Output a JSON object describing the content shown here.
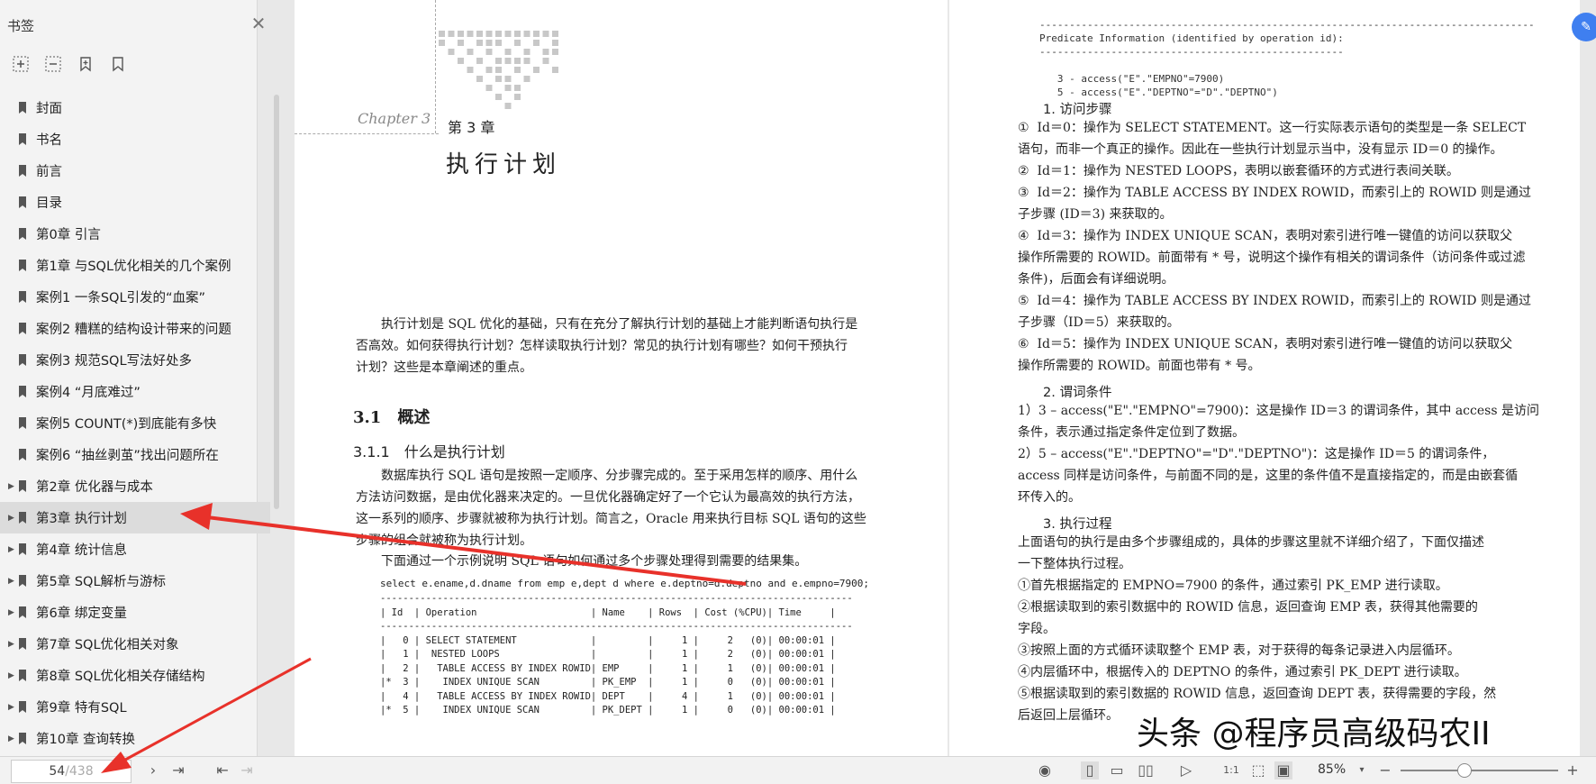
{
  "sidebar": {
    "title": "书签",
    "items": [
      {
        "label": "封面",
        "expandable": false
      },
      {
        "label": "书名",
        "expandable": false
      },
      {
        "label": "前言",
        "expandable": false
      },
      {
        "label": "目录",
        "expandable": false
      },
      {
        "label": "第0章 引言",
        "expandable": false
      },
      {
        "label": "第1章 与SQL优化相关的几个案例",
        "expandable": false
      },
      {
        "label": "案例1 一条SQL引发的“血案”",
        "expandable": false
      },
      {
        "label": "案例2 糟糕的结构设计带来的问题",
        "expandable": false
      },
      {
        "label": "案例3 规范SQL写法好处多",
        "expandable": false
      },
      {
        "label": "案例4 “月底难过”",
        "expandable": false
      },
      {
        "label": "案例5 COUNT(*)到底能有多快",
        "expandable": false
      },
      {
        "label": "案例6 “抽丝剥茧”找出问题所在",
        "expandable": false
      },
      {
        "label": "第2章 优化器与成本",
        "expandable": true
      },
      {
        "label": "第3章 执行计划",
        "expandable": true,
        "active": true
      },
      {
        "label": "第4章 统计信息",
        "expandable": true
      },
      {
        "label": "第5章 SQL解析与游标",
        "expandable": true
      },
      {
        "label": "第6章 绑定变量",
        "expandable": true
      },
      {
        "label": "第7章 SQL优化相关对象",
        "expandable": true
      },
      {
        "label": "第8章 SQL优化相关存储结构",
        "expandable": true
      },
      {
        "label": "第9章 特有SQL",
        "expandable": true
      },
      {
        "label": "第10章 查询转换",
        "expandable": true
      }
    ]
  },
  "page_left": {
    "chapter_cursive": "Chapter 3",
    "chapter_num": "第 3 章",
    "chapter_title": "执行计划",
    "intro": [
      "执行计划是 SQL 优化的基础，只有在充分了解执行计划的基础上才能判断语句执行是",
      "否高效。如何获得执行计划？怎样读取执行计划？常见的执行计划有哪些？如何干预执行",
      "计划？这些是本章阐述的重点。"
    ],
    "section": "3.1　概述",
    "subsection": "3.1.1　什么是执行计划",
    "body": [
      "数据库执行 SQL 语句是按照一定顺序、分步骤完成的。至于采用怎样的顺序、用什么",
      "方法访问数据，是由优化器来决定的。一旦优化器确定好了一个它认为最高效的执行方法，",
      "这一系列的顺序、步骤就被称为执行计划。简言之，Oracle 用来执行目标 SQL 语句的这些",
      "步骤的组合就被称为执行计划。"
    ],
    "example_intro": "下面通过一个示例说明 SQL 语句如何通过多个步骤处理得到需要的结果集。",
    "sql": "select e.ename,d.dname from emp e,dept d where e.deptno=d.deptno and e.empno=7900;",
    "plan_lines": [
      "-----------------------------------------------------------------------------------",
      "| Id  | Operation                    | Name    | Rows  | Cost (%CPU)| Time     |",
      "-----------------------------------------------------------------------------------",
      "|   0 | SELECT STATEMENT             |         |     1 |     2   (0)| 00:00:01 |",
      "|   1 |  NESTED LOOPS                |         |     1 |     2   (0)| 00:00:01 |",
      "|   2 |   TABLE ACCESS BY INDEX ROWID| EMP     |     1 |     1   (0)| 00:00:01 |",
      "|*  3 |    INDEX UNIQUE SCAN         | PK_EMP  |     1 |     0   (0)| 00:00:01 |",
      "|   4 |   TABLE ACCESS BY INDEX ROWID| DEPT    |     4 |     1   (0)| 00:00:01 |",
      "|*  5 |    INDEX UNIQUE SCAN         | PK_DEPT |     1 |     0   (0)| 00:00:01 |"
    ]
  },
  "page_right": {
    "pred_lines": [
      "-----------------------------------------------------------------------------------",
      "Predicate Information (identified by operation id):",
      "---------------------------------------------------",
      "",
      "   3 - access(\"E\".\"EMPNO\"=7900)",
      "   5 - access(\"E\".\"DEPTNO\"=\"D\".\"DEPTNO\")"
    ],
    "h1": "1. 访问步骤",
    "steps": [
      "①  Id＝0：操作为 SELECT STATEMENT。这一行实际表示语句的类型是一条 SELECT",
      "语句，而非一个真正的操作。因此在一些执行计划显示当中，没有显示 ID＝0 的操作。",
      "②  Id＝1：操作为 NESTED LOOPS，表明以嵌套循环的方式进行表间关联。",
      "③  Id＝2：操作为 TABLE ACCESS BY INDEX ROWID，而索引上的 ROWID 则是通过",
      "子步骤 (ID＝3) 来获取的。",
      "④  Id＝3：操作为 INDEX UNIQUE SCAN，表明对索引进行唯一键值的访问以获取父",
      "操作所需要的 ROWID。前面带有 * 号，说明这个操作有相关的谓词条件（访问条件或过滤",
      "条件)，后面会有详细说明。",
      "⑤  Id＝4：操作为 TABLE ACCESS BY INDEX ROWID，而索引上的 ROWID 则是通过",
      "子步骤（ID＝5）来获取的。",
      "⑥  Id＝5：操作为 INDEX UNIQUE SCAN，表明对索引进行唯一键值的访问以获取父",
      "操作所需要的 ROWID。前面也带有 * 号。"
    ],
    "h2": "2. 谓词条件",
    "preds": [
      "1）3 – access(\"E\".\"EMPNO\"=7900)：这是操作 ID＝3 的谓词条件，其中 access 是访问",
      "条件，表示通过指定条件定位到了数据。",
      "2）5 – access(\"E\".\"DEPTNO\"=\"D\".\"DEPTNO\")：这是操作 ID＝5 的谓词条件，",
      "access 同样是访问条件，与前面不同的是，这里的条件值不是直接指定的，而是由嵌套循",
      "环传入的。"
    ],
    "h3": "3. 执行过程",
    "exec": [
      "上面语句的执行是由多个步骤组成的，具体的步骤这里就不详细介绍了，下面仅描述",
      "一下整体执行过程。",
      "①首先根据指定的 EMPNO=7900 的条件，通过索引 PK_EMP 进行读取。",
      "②根据读取到的索引数据中的 ROWID 信息，返回查询 EMP 表，获得其他需要的",
      "字段。",
      "③按照上面的方式循环读取整个 EMP 表，对于获得的每条记录进入内层循环。",
      "④内层循环中，根据传入的 DEPTNO 的条件，通过索引 PK_DEPT 进行读取。",
      "⑤根据读取到的索引数据的 ROWID 信息，返回查询 DEPT 表，获得需要的字段，然",
      "后返回上层循环。"
    ]
  },
  "watermark": "头条 @程序员高级码农II",
  "bottom": {
    "current_page": "54",
    "total_pages": "/438",
    "zoom": "85%"
  },
  "colors": {
    "arrow": "#e8312a",
    "active_row": "#dcdcdc",
    "fab": "#3f7ff0"
  }
}
